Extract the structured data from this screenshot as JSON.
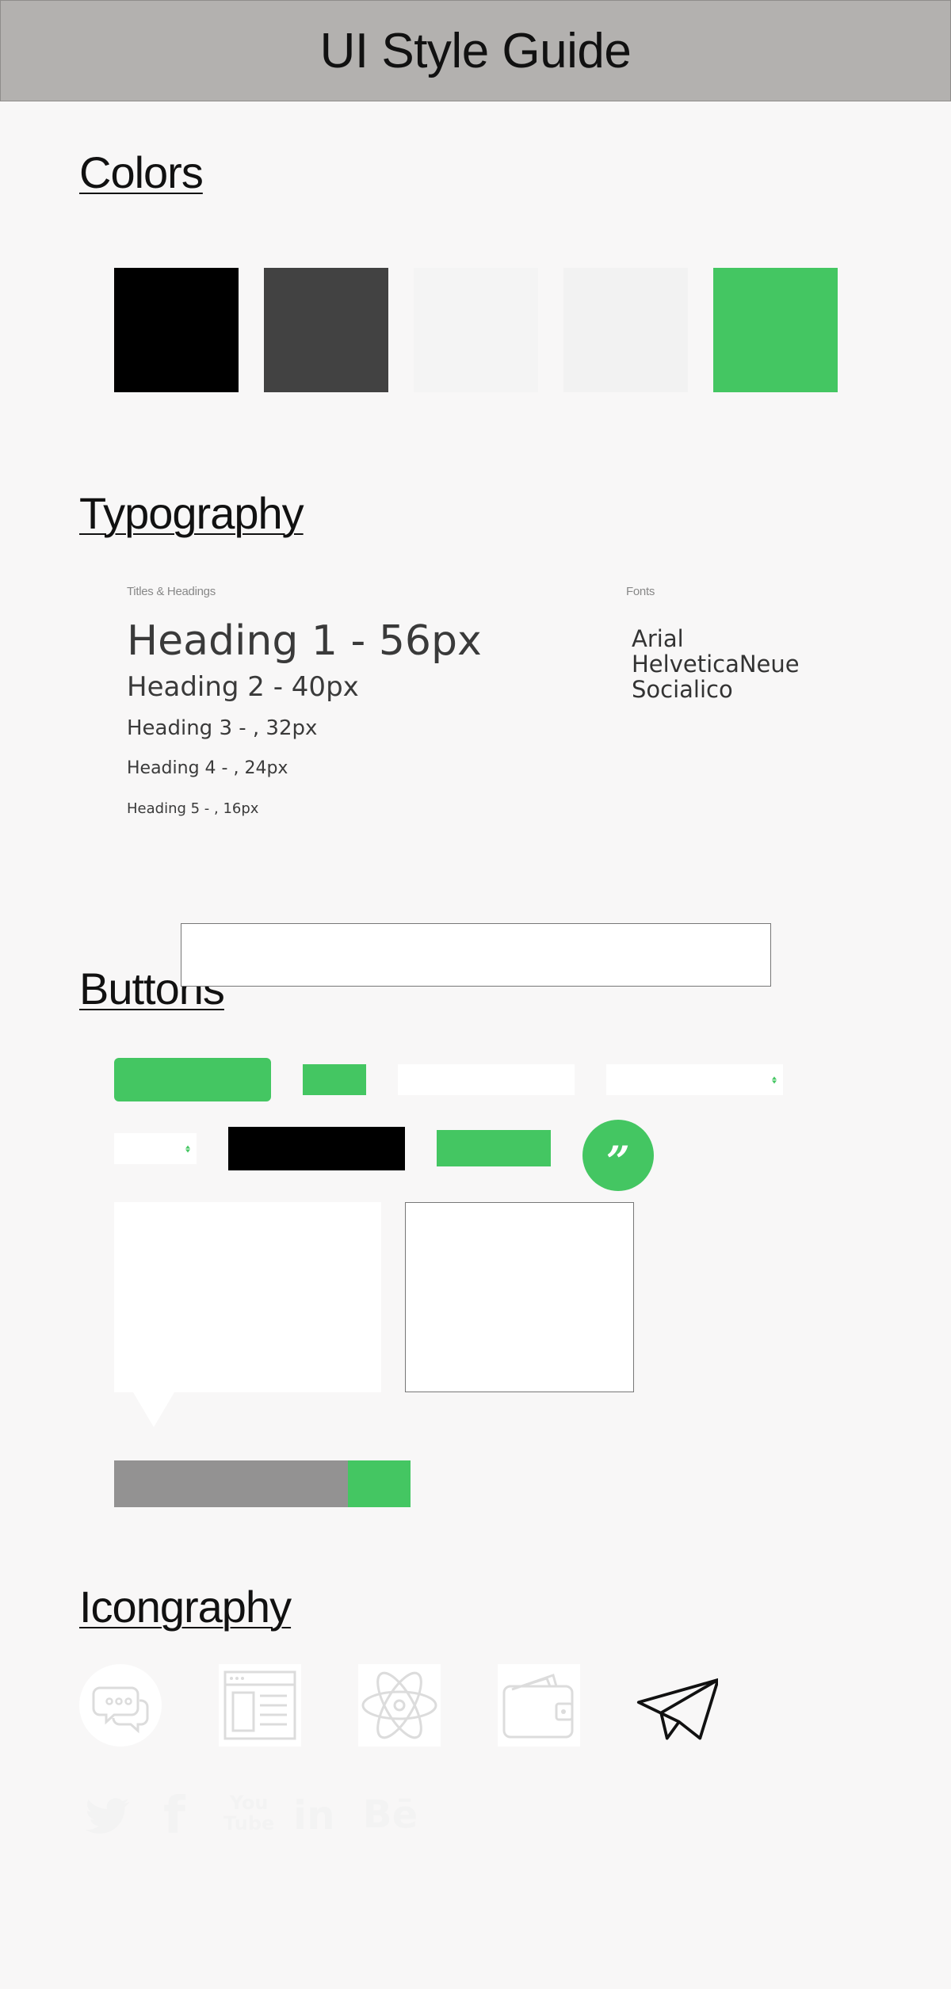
{
  "header": {
    "title": "UI Style Guide"
  },
  "colors": {
    "title": "Colors",
    "swatches": [
      "#000000",
      "#424242",
      "#f4f4f4",
      "#f2f2f2",
      "#44c662"
    ]
  },
  "typography": {
    "title": "Typography",
    "headings_label": "Titles & Headings",
    "fonts_label": "Fonts",
    "headings": [
      "Heading 1 - 56px",
      "Heading 2 - 40px",
      "Heading 3 - , 32px",
      "Heading 4 - , 24px",
      "Heading 5 - , 16px"
    ],
    "fonts": [
      "Arial",
      "HelveticaNeue",
      "Socialico"
    ]
  },
  "buttons": {
    "title": "Buttons",
    "quote_glyph": "”",
    "progress_fraction": 0.79
  },
  "iconography": {
    "title": "Icongraphy",
    "icons": [
      "chat-bubbles-icon",
      "browser-window-icon",
      "atom-icon",
      "wallet-icon",
      "paper-plane-icon"
    ],
    "social": [
      "twitter-icon",
      "facebook-icon",
      "youtube-icon",
      "linkedin-icon",
      "behance-icon"
    ],
    "youtube_text": [
      "You",
      "Tube"
    ],
    "facebook_text": "f",
    "linkedin_text": "in",
    "behance_text": "Bē"
  }
}
